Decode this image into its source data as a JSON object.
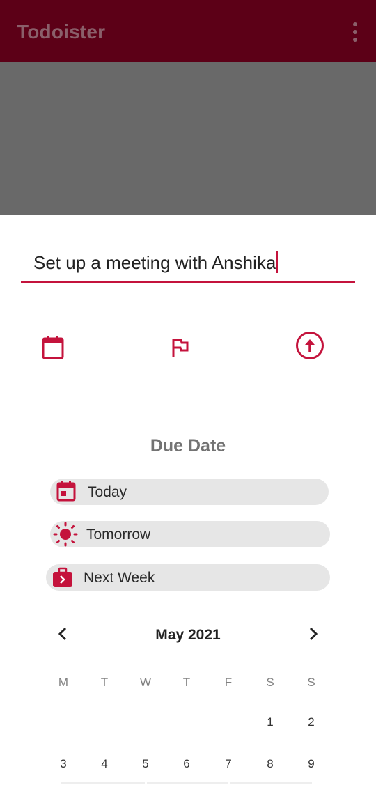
{
  "app": {
    "title": "Todoister"
  },
  "task": {
    "text": "Set up a meeting with Anshika"
  },
  "due": {
    "heading": "Due Date",
    "options": [
      {
        "label": "Today",
        "icon": "calendar-today-icon"
      },
      {
        "label": "Tomorrow",
        "icon": "sun-icon"
      },
      {
        "label": "Next Week",
        "icon": "briefcase-next-icon"
      }
    ]
  },
  "calendar": {
    "month": "May 2021",
    "weekdays": [
      "M",
      "T",
      "W",
      "T",
      "F",
      "S",
      "S"
    ],
    "days_row1": [
      "1",
      "2"
    ],
    "days_row2": [
      "3",
      "4",
      "5",
      "6",
      "7",
      "8",
      "9"
    ]
  },
  "colors": {
    "appbar": "#5c0017",
    "accent": "#c4133c",
    "scrim": "#696969",
    "chip": "#e6e6e6"
  },
  "icons": {
    "date": "calendar-icon",
    "priority": "flag-icon",
    "save": "arrow-up-circle-icon",
    "prev": "chevron-left-icon",
    "next": "chevron-right-icon"
  }
}
